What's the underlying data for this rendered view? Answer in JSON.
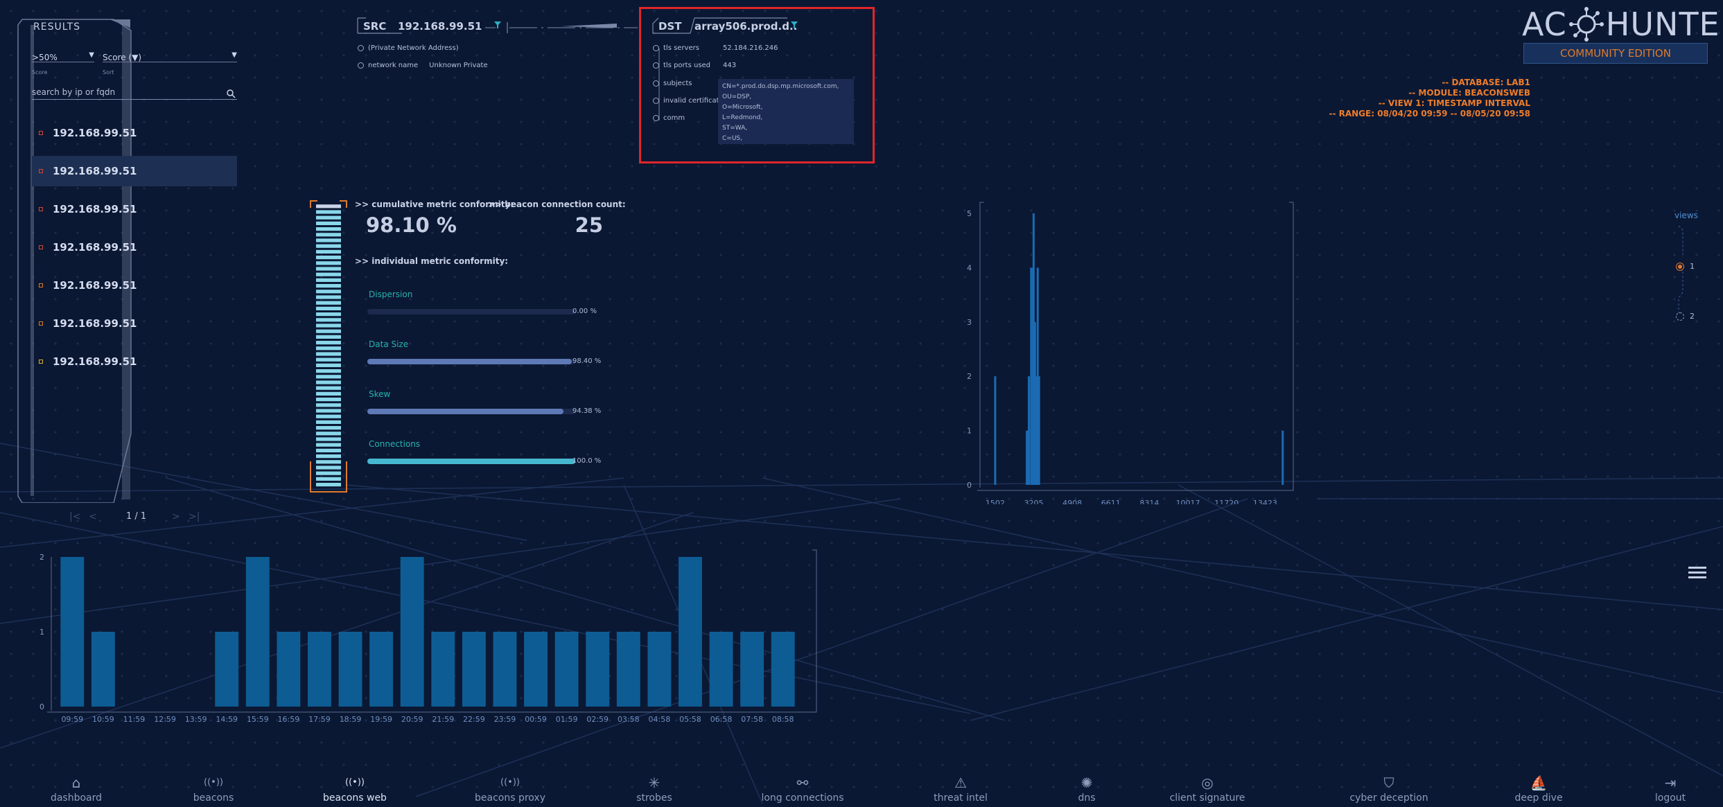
{
  "results": {
    "title": "RESULTS",
    "score_filter": {
      "value": ">50%",
      "label": "Score"
    },
    "sort": {
      "value": "Score (▼)",
      "label": "Sort"
    },
    "search_placeholder": "search by ip or fqdn",
    "items": [
      {
        "ip": "192.168.99.51",
        "dot_color": "#d04a3a"
      },
      {
        "ip": "192.168.99.51",
        "dot_color": "#d04a3a"
      },
      {
        "ip": "192.168.99.51",
        "dot_color": "#d04a3a"
      },
      {
        "ip": "192.168.99.51",
        "dot_color": "#d04a3a"
      },
      {
        "ip": "192.168.99.51",
        "dot_color": "#e07b2e"
      },
      {
        "ip": "192.168.99.51",
        "dot_color": "#e07b2e"
      },
      {
        "ip": "192.168.99.51",
        "dot_color": "#e0b22e"
      }
    ],
    "pager": "1 / 1"
  },
  "src": {
    "tag": "SRC",
    "ip": "192.168.99.51",
    "private_label": "(Private Network Address)",
    "network_name_label": "network name",
    "network_name_value": "Unknown Private"
  },
  "dst": {
    "tag": "DST",
    "host": "array506.prod.d...",
    "tls_servers_label": "tls servers",
    "tls_servers_value": "52.184.216.246",
    "tls_ports_label": "tls ports used",
    "tls_ports_value": "443",
    "subjects_label": "subjects",
    "invalid_cert_label": "invalid certificate",
    "comm_label": "comm",
    "subjects_lines": [
      "CN=*.prod.do.dsp.mp.microsoft.com,",
      "OU=DSP,",
      "O=Microsoft,",
      "L=Redmond,",
      "ST=WA,",
      "C=US,"
    ]
  },
  "logo": {
    "left": "AC",
    "right": "HUNTER",
    "edition": "COMMUNITY EDITION"
  },
  "db_info": [
    "-- DATABASE: LAB1",
    "-- MODULE: BEACONSWEB",
    "-- VIEW 1: TIMESTAMP INTERVAL",
    "-- RANGE: 08/04/20 09:59 -- 08/05/20 09:58"
  ],
  "metrics": {
    "cumulative_label": ">> cumulative metric conformity:",
    "cumulative_value": "98.10 %",
    "count_label": ">> beacon connection count:",
    "count_value": "25",
    "individual_label": ">> individual metric conformity:",
    "items": [
      {
        "name": "Dispersion",
        "value": 0.0,
        "text": "0.00 %",
        "kind": "normal"
      },
      {
        "name": "Data Size",
        "value": 98.4,
        "text": "98.40 %",
        "kind": "normal"
      },
      {
        "name": "Skew",
        "value": 94.38,
        "text": "94.38 %",
        "kind": "normal"
      },
      {
        "name": "Connections",
        "value": 100.0,
        "text": "100.0 %",
        "kind": "conn"
      }
    ]
  },
  "views": {
    "label": "views",
    "options": [
      "1",
      "2"
    ],
    "selected": "1"
  },
  "nav": [
    {
      "label": "dashboard",
      "icon": "home-icon",
      "glyph": "⌂"
    },
    {
      "label": "beacons",
      "icon": "broadcast-icon",
      "glyph": "((•))"
    },
    {
      "label": "beacons web",
      "icon": "broadcast-web-icon",
      "glyph": "((•))",
      "active": true
    },
    {
      "label": "beacons proxy",
      "icon": "broadcast-proxy-icon",
      "glyph": "((•))"
    },
    {
      "label": "strobes",
      "icon": "strobe-icon",
      "glyph": "✳"
    },
    {
      "label": "long connections",
      "icon": "connections-icon",
      "glyph": "⚯"
    },
    {
      "label": "threat intel",
      "icon": "warning-icon",
      "glyph": "⚠"
    },
    {
      "label": "dns",
      "icon": "dns-icon",
      "glyph": "✺"
    },
    {
      "label": "client signature",
      "icon": "fingerprint-icon",
      "glyph": "◎"
    },
    {
      "label": "cyber deception",
      "icon": "shield-icon",
      "glyph": "⛉"
    },
    {
      "label": "deep dive",
      "icon": "dive-icon",
      "glyph": "⛵"
    },
    {
      "label": "logout",
      "icon": "logout-icon",
      "glyph": "⇥"
    }
  ],
  "chart_data": [
    {
      "type": "bar",
      "title": "",
      "categories": [
        "09:59",
        "10:59",
        "11:59",
        "12:59",
        "13:59",
        "14:59",
        "15:59",
        "16:59",
        "17:59",
        "18:59",
        "19:59",
        "20:59",
        "21:59",
        "22:59",
        "23:59",
        "00:59",
        "01:59",
        "02:59",
        "03:58",
        "04:58",
        "05:58",
        "06:58",
        "07:58",
        "08:58"
      ],
      "values": [
        2,
        1,
        0,
        0,
        0,
        1,
        2,
        1,
        1,
        1,
        1,
        2,
        1,
        1,
        1,
        1,
        1,
        1,
        1,
        1,
        2,
        1,
        1,
        1
      ],
      "ylim": [
        0,
        2
      ],
      "yticks": [
        "0",
        "1",
        "2"
      ],
      "color": "#0d5d94"
    },
    {
      "type": "bar",
      "title": "",
      "xticks": [
        "1502",
        "3205",
        "4908",
        "6611",
        "8314",
        "10017",
        "11720",
        "13423"
      ],
      "x": [
        1502,
        2900,
        2990,
        3090,
        3140,
        3200,
        3260,
        3320,
        3380,
        3440,
        14200
      ],
      "values": [
        2,
        1,
        2,
        4,
        4,
        5,
        3,
        2,
        4,
        2,
        1
      ],
      "xlim": [
        1200,
        14300
      ],
      "ylim": [
        0,
        5
      ],
      "yticks": [
        "0",
        "1",
        "2",
        "3",
        "4",
        "5"
      ],
      "color": "#1b6bb3"
    }
  ]
}
